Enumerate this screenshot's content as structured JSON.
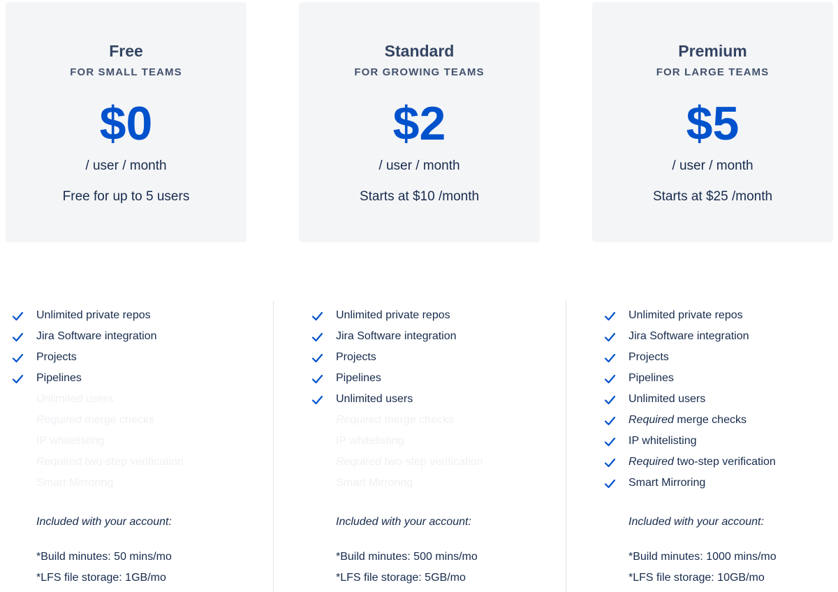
{
  "plans": [
    {
      "name": "Free",
      "subtitle": "FOR SMALL TEAMS",
      "price": "$0",
      "per": "/ user / month",
      "note": "Free for up to 5 users",
      "features": [
        {
          "emph": "",
          "text": "Unlimited private repos",
          "included": true
        },
        {
          "emph": "",
          "text": "Jira Software integration",
          "included": true
        },
        {
          "emph": "",
          "text": "Projects",
          "included": true
        },
        {
          "emph": "",
          "text": "Pipelines",
          "included": true
        },
        {
          "emph": "",
          "text": "Unlimited users",
          "included": false
        },
        {
          "emph": "Required",
          "text": " merge checks",
          "included": false
        },
        {
          "emph": "",
          "text": "IP whitelisting",
          "included": false
        },
        {
          "emph": "Required",
          "text": " two-step verification",
          "included": false
        },
        {
          "emph": "",
          "text": "Smart Mirroring",
          "included": false
        }
      ],
      "included_title": "Included with your account:",
      "build_minutes": "*Build minutes: 50 mins/mo",
      "lfs_storage": "*LFS file storage: 1GB/mo"
    },
    {
      "name": "Standard",
      "subtitle": "FOR GROWING TEAMS",
      "price": "$2",
      "per": "/ user / month",
      "note": "Starts at $10 /month",
      "features": [
        {
          "emph": "",
          "text": "Unlimited private repos",
          "included": true
        },
        {
          "emph": "",
          "text": "Jira Software integration",
          "included": true
        },
        {
          "emph": "",
          "text": "Projects",
          "included": true
        },
        {
          "emph": "",
          "text": "Pipelines",
          "included": true
        },
        {
          "emph": "",
          "text": "Unlimited users",
          "included": true
        },
        {
          "emph": "Required",
          "text": " merge checks",
          "included": false
        },
        {
          "emph": "",
          "text": "IP whitelisting",
          "included": false
        },
        {
          "emph": "Required",
          "text": " two-step verification",
          "included": false
        },
        {
          "emph": "",
          "text": "Smart Mirroring",
          "included": false
        }
      ],
      "included_title": "Included with your account:",
      "build_minutes": "*Build minutes: 500 mins/mo",
      "lfs_storage": "*LFS file storage: 5GB/mo"
    },
    {
      "name": "Premium",
      "subtitle": "FOR LARGE TEAMS",
      "price": "$5",
      "per": "/ user / month",
      "note": "Starts at $25 /month",
      "features": [
        {
          "emph": "",
          "text": "Unlimited private repos",
          "included": true
        },
        {
          "emph": "",
          "text": "Jira Software integration",
          "included": true
        },
        {
          "emph": "",
          "text": "Projects",
          "included": true
        },
        {
          "emph": "",
          "text": "Pipelines",
          "included": true
        },
        {
          "emph": "",
          "text": "Unlimited users",
          "included": true
        },
        {
          "emph": "Required",
          "text": " merge checks",
          "included": true
        },
        {
          "emph": "",
          "text": "IP whitelisting",
          "included": true
        },
        {
          "emph": "Required",
          "text": " two-step verification",
          "included": true
        },
        {
          "emph": "",
          "text": "Smart Mirroring",
          "included": true
        }
      ],
      "included_title": "Included with your account:",
      "build_minutes": "*Build minutes: 1000 mins/mo",
      "lfs_storage": "*LFS file storage: 10GB/mo"
    }
  ],
  "colors": {
    "accent": "#0052cc",
    "card_bg": "#f4f5f7",
    "text": "#172b4d",
    "disabled_text": "#eef0f3",
    "divider": "#dfe1e6"
  },
  "icons": {
    "check": "check-icon"
  }
}
